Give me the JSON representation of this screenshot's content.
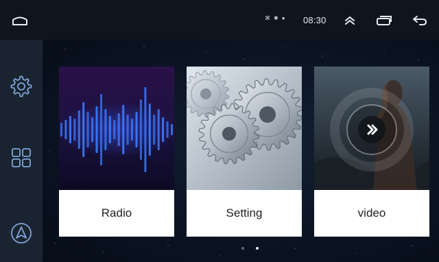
{
  "status_bar": {
    "clock": "08:30",
    "indicators": [
      "signal-icon",
      "bluetooth-icon",
      "gps-icon"
    ]
  },
  "top_nav": {
    "home_icon": "home-icon",
    "up_icon": "chevrons-up-icon",
    "recents_icon": "recent-apps-icon",
    "back_icon": "back-arrow-icon"
  },
  "sidebar": {
    "items": [
      {
        "icon": "gear-icon"
      },
      {
        "icon": "app-grid-icon"
      },
      {
        "icon": "navigation-icon"
      }
    ]
  },
  "apps": [
    {
      "label": "Radio",
      "art": "radio-waveform"
    },
    {
      "label": "Setting",
      "art": "gears"
    },
    {
      "label": "video",
      "art": "movie-poster-play"
    }
  ],
  "pager": {
    "pages": 2,
    "current": 2
  },
  "colors": {
    "background": "#0b1423",
    "topbar": "#0f151d",
    "sidebar": "#1a2430",
    "waveform": "#2f6dff",
    "card_label_bg": "#ffffff"
  }
}
